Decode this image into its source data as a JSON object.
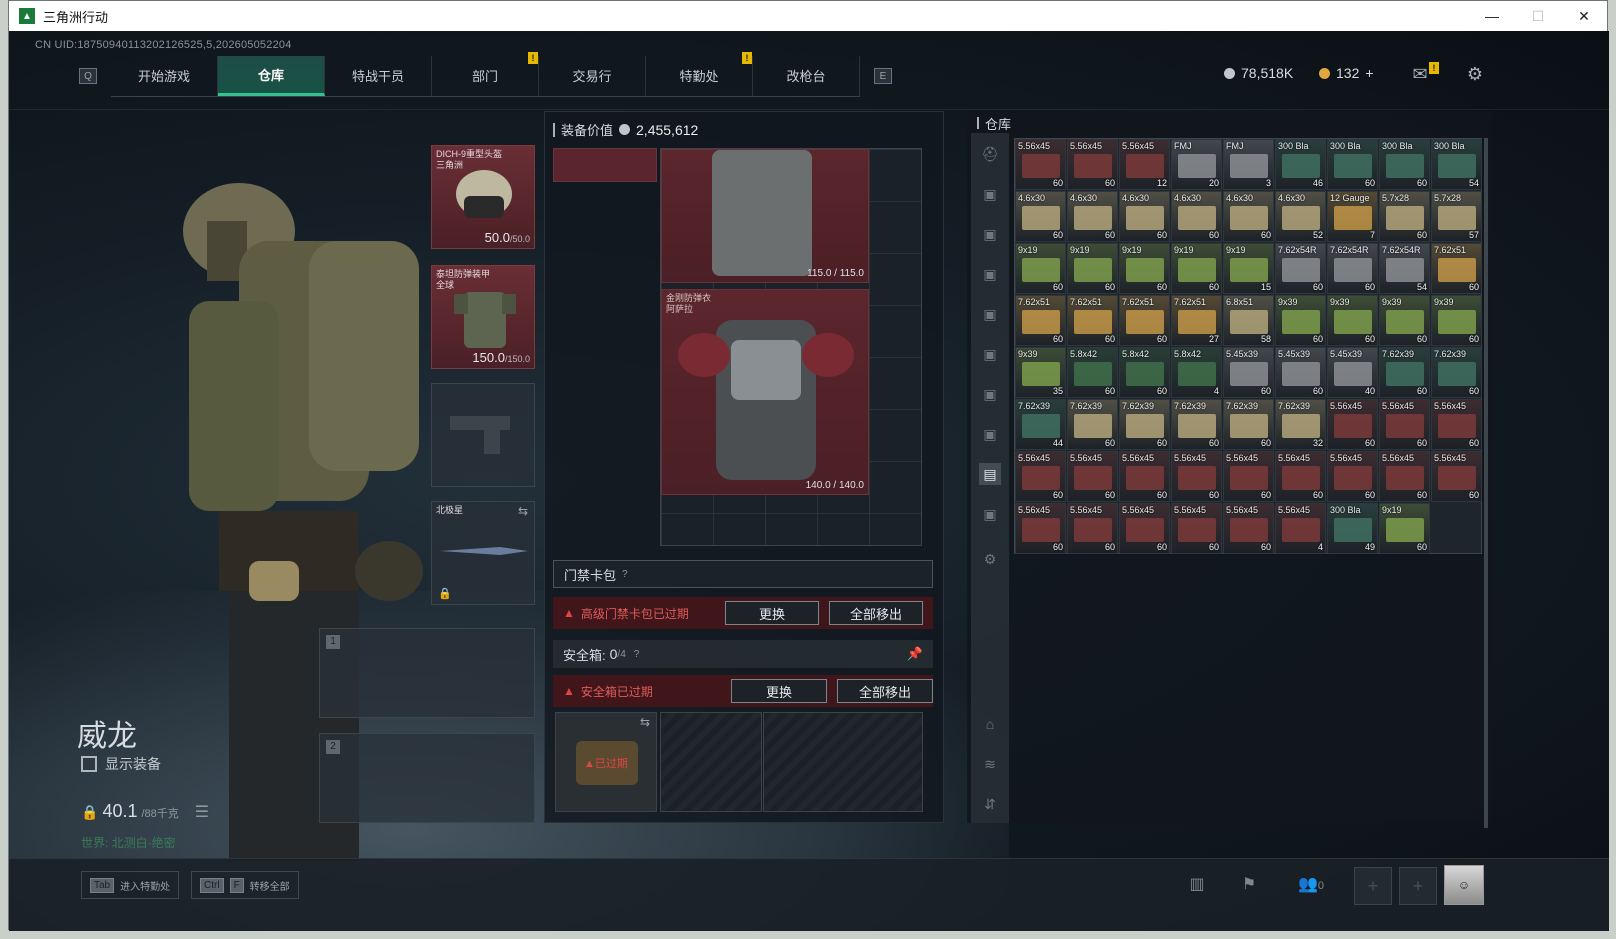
{
  "window": {
    "title": "三角洲行动",
    "btn_min": "—",
    "btn_max": "☐",
    "btn_close": "✕"
  },
  "uid": "CN UID:18750940113202126525,5,202605052204",
  "nav": {
    "left_key": "Q",
    "right_key": "E",
    "tabs": [
      "开始游戏",
      "仓库",
      "特战干员",
      "部门",
      "交易行",
      "特勤处",
      "改枪台"
    ],
    "active_index": 1,
    "notif_mark": "!"
  },
  "currency": {
    "silver": "78,518K",
    "gold": "132",
    "gold_plus": "+"
  },
  "colors": {
    "accent": "#34c38e",
    "alert": "#e04545",
    "gold": "#e0a640",
    "silver": "#c0c6cb"
  },
  "character": {
    "name": "威龙",
    "show_equipment": "显示装备",
    "weight": "40.1",
    "weight_max": "/88千克",
    "location": "世界: 北测白·绝密"
  },
  "equipment": {
    "helmet": {
      "name": "DICH-9重型头盔",
      "sub": "三角洲",
      "durability": "50.0",
      "durability_max": "/50.0"
    },
    "armor": {
      "name": "泰坦防弹装甲",
      "sub": "全球",
      "durability": "150.0",
      "durability_max": "/150.0"
    },
    "melee": {
      "name": "北极星"
    },
    "slot1": "1",
    "slot2": "2"
  },
  "center": {
    "equip_value_label": "装备价值",
    "equip_value": "2,455,612",
    "rig1_durability": "115.0 / 115.0",
    "rig2_name": "金刚防弹衣",
    "rig2_sub": "阿萨拉",
    "rig2_durability": "140.0 / 140.0",
    "keycard_label": "门禁卡包",
    "keycard_alert": "高级门禁卡包已过期",
    "replace": "更换",
    "remove_all": "全部移出",
    "safebox_label": "安全箱:",
    "safebox_count": "0",
    "safebox_max": "/4",
    "safebox_alert": "安全箱已过期",
    "expired": "已过期",
    "help": "?"
  },
  "warehouse": {
    "title": "仓库",
    "items": [
      {
        "n": "5.56x45",
        "c": "60",
        "k": "r"
      },
      {
        "n": "5.56x45",
        "c": "60",
        "k": "r"
      },
      {
        "n": "5.56x45",
        "c": "12",
        "k": "r"
      },
      {
        "n": "FMJ",
        "c": "20",
        "k": "w"
      },
      {
        "n": "FMJ",
        "c": "3",
        "k": "w"
      },
      {
        "n": "300 Bla",
        "c": "46",
        "k": "t"
      },
      {
        "n": "300 Bla",
        "c": "60",
        "k": "t"
      },
      {
        "n": "300 Bla",
        "c": "60",
        "k": "t"
      },
      {
        "n": "300 Bla",
        "c": "54",
        "k": "t"
      },
      {
        "n": "4.6x30",
        "c": "60",
        "k": "b"
      },
      {
        "n": "4.6x30",
        "c": "60",
        "k": "b"
      },
      {
        "n": "4.6x30",
        "c": "60",
        "k": "b"
      },
      {
        "n": "4.6x30",
        "c": "60",
        "k": "b"
      },
      {
        "n": "4.6x30",
        "c": "60",
        "k": "b"
      },
      {
        "n": "4.6x30",
        "c": "52",
        "k": "b"
      },
      {
        "n": "12 Gauge",
        "c": "7",
        "k": "y"
      },
      {
        "n": "5.7x28",
        "c": "60",
        "k": "b"
      },
      {
        "n": "5.7x28",
        "c": "57",
        "k": "b"
      },
      {
        "n": "9x19",
        "c": "60",
        "k": "g"
      },
      {
        "n": "9x19",
        "c": "60",
        "k": "g"
      },
      {
        "n": "9x19",
        "c": "60",
        "k": "g"
      },
      {
        "n": "9x19",
        "c": "60",
        "k": "g"
      },
      {
        "n": "9x19",
        "c": "15",
        "k": "g"
      },
      {
        "n": "7.62x54R",
        "c": "60",
        "k": "w"
      },
      {
        "n": "7.62x54R",
        "c": "60",
        "k": "w"
      },
      {
        "n": "7.62x54R",
        "c": "54",
        "k": "w"
      },
      {
        "n": "7.62x51",
        "c": "60",
        "k": "y"
      },
      {
        "n": "7.62x51",
        "c": "60",
        "k": "y"
      },
      {
        "n": "7.62x51",
        "c": "60",
        "k": "y"
      },
      {
        "n": "7.62x51",
        "c": "60",
        "k": "y"
      },
      {
        "n": "7.62x51",
        "c": "27",
        "k": "y"
      },
      {
        "n": "6.8x51",
        "c": "58",
        "k": "b"
      },
      {
        "n": "9x39",
        "c": "60",
        "k": "g"
      },
      {
        "n": "9x39",
        "c": "60",
        "k": "g"
      },
      {
        "n": "9x39",
        "c": "60",
        "k": "g"
      },
      {
        "n": "9x39",
        "c": "60",
        "k": "g"
      },
      {
        "n": "9x39",
        "c": "35",
        "k": "g"
      },
      {
        "n": "5.8x42",
        "c": "60",
        "k": "dg"
      },
      {
        "n": "5.8x42",
        "c": "60",
        "k": "dg"
      },
      {
        "n": "5.8x42",
        "c": "4",
        "k": "dg"
      },
      {
        "n": "5.45x39",
        "c": "60",
        "k": "w"
      },
      {
        "n": "5.45x39",
        "c": "60",
        "k": "w"
      },
      {
        "n": "5.45x39",
        "c": "40",
        "k": "w"
      },
      {
        "n": "7.62x39",
        "c": "60",
        "k": "t"
      },
      {
        "n": "7.62x39",
        "c": "60",
        "k": "t"
      },
      {
        "n": "7.62x39",
        "c": "44",
        "k": "t"
      },
      {
        "n": "7.62x39",
        "c": "60",
        "k": "b"
      },
      {
        "n": "7.62x39",
        "c": "60",
        "k": "b"
      },
      {
        "n": "7.62x39",
        "c": "60",
        "k": "b"
      },
      {
        "n": "7.62x39",
        "c": "60",
        "k": "b"
      },
      {
        "n": "7.62x39",
        "c": "32",
        "k": "b"
      },
      {
        "n": "5.56x45",
        "c": "60",
        "k": "r"
      },
      {
        "n": "5.56x45",
        "c": "60",
        "k": "r"
      },
      {
        "n": "5.56x45",
        "c": "60",
        "k": "r"
      },
      {
        "n": "5.56x45",
        "c": "60",
        "k": "r"
      },
      {
        "n": "5.56x45",
        "c": "60",
        "k": "r"
      },
      {
        "n": "5.56x45",
        "c": "60",
        "k": "r"
      },
      {
        "n": "5.56x45",
        "c": "60",
        "k": "r"
      },
      {
        "n": "5.56x45",
        "c": "60",
        "k": "r"
      },
      {
        "n": "5.56x45",
        "c": "60",
        "k": "r"
      },
      {
        "n": "5.56x45",
        "c": "60",
        "k": "r"
      },
      {
        "n": "5.56x45",
        "c": "60",
        "k": "r"
      },
      {
        "n": "5.56x45",
        "c": "60",
        "k": "r"
      },
      {
        "n": "5.56x45",
        "c": "60",
        "k": "r"
      },
      {
        "n": "5.56x45",
        "c": "60",
        "k": "r"
      },
      {
        "n": "5.56x45",
        "c": "60",
        "k": "r"
      },
      {
        "n": "5.56x45",
        "c": "60",
        "k": "r"
      },
      {
        "n": "5.56x45",
        "c": "60",
        "k": "r"
      },
      {
        "n": "5.56x45",
        "c": "4",
        "k": "r"
      },
      {
        "n": "300 Bla",
        "c": "49",
        "k": "t"
      },
      {
        "n": "9x19",
        "c": "60",
        "k": "g"
      }
    ]
  },
  "bottom": {
    "hint1_key": "Tab",
    "hint1_text": "进入特勤处",
    "hint2_key1": "Ctrl",
    "hint2_key2": "F",
    "hint2_text": "转移全部",
    "squad_count": "0",
    "add": "+"
  }
}
